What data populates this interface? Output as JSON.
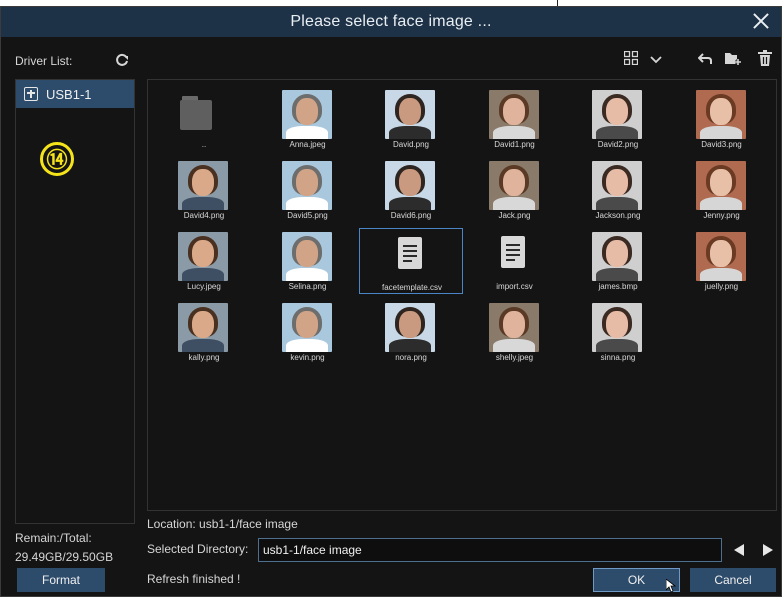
{
  "dialog": {
    "title": "Please select face image ..."
  },
  "sidebar": {
    "driver_list_label": "Driver List:",
    "drives": [
      {
        "label": "USB1-1",
        "selected": true
      }
    ],
    "step_badge": "⑭",
    "remain_label": "Remain:/Total:",
    "remain_value": "29.49GB/29.50GB",
    "format_label": "Format"
  },
  "toolbar": {
    "icons": [
      "grid-view-icon",
      "chevron-down-icon",
      "back-icon",
      "new-folder-icon",
      "trash-icon"
    ]
  },
  "files": [
    {
      "name": "..",
      "type": "folder"
    },
    {
      "name": "Anna.jpeg",
      "type": "image"
    },
    {
      "name": "David.png",
      "type": "image"
    },
    {
      "name": "David1.png",
      "type": "image"
    },
    {
      "name": "David2.png",
      "type": "image"
    },
    {
      "name": "David3.png",
      "type": "image"
    },
    {
      "name": "David4.png",
      "type": "image"
    },
    {
      "name": "David5.png",
      "type": "image"
    },
    {
      "name": "David6.png",
      "type": "image"
    },
    {
      "name": "Jack.png",
      "type": "image"
    },
    {
      "name": "Jackson.png",
      "type": "image"
    },
    {
      "name": "Jenny.png",
      "type": "image"
    },
    {
      "name": "Lucy.jpeg",
      "type": "image"
    },
    {
      "name": "Selina.png",
      "type": "image"
    },
    {
      "name": "facetemplate.csv",
      "type": "csv",
      "selected": true
    },
    {
      "name": "import.csv",
      "type": "csv"
    },
    {
      "name": "james.bmp",
      "type": "image"
    },
    {
      "name": "juelly.png",
      "type": "image"
    },
    {
      "name": "kally.png",
      "type": "image"
    },
    {
      "name": "kevin.png",
      "type": "image"
    },
    {
      "name": "nora.png",
      "type": "image"
    },
    {
      "name": "shelly.jpeg",
      "type": "image"
    },
    {
      "name": "sinna.png",
      "type": "image"
    }
  ],
  "footer": {
    "location": "Location: usb1-1/face image",
    "selected_directory_label": "Selected Directory:",
    "selected_directory_value": "usb1-1/face image",
    "status": "Refresh finished !",
    "ok_label": "OK",
    "cancel_label": "Cancel"
  },
  "colors": {
    "titlebar": "#1e3247",
    "accent": "#2d4b6b",
    "background": "#141414",
    "badge": "#f5e41a"
  }
}
